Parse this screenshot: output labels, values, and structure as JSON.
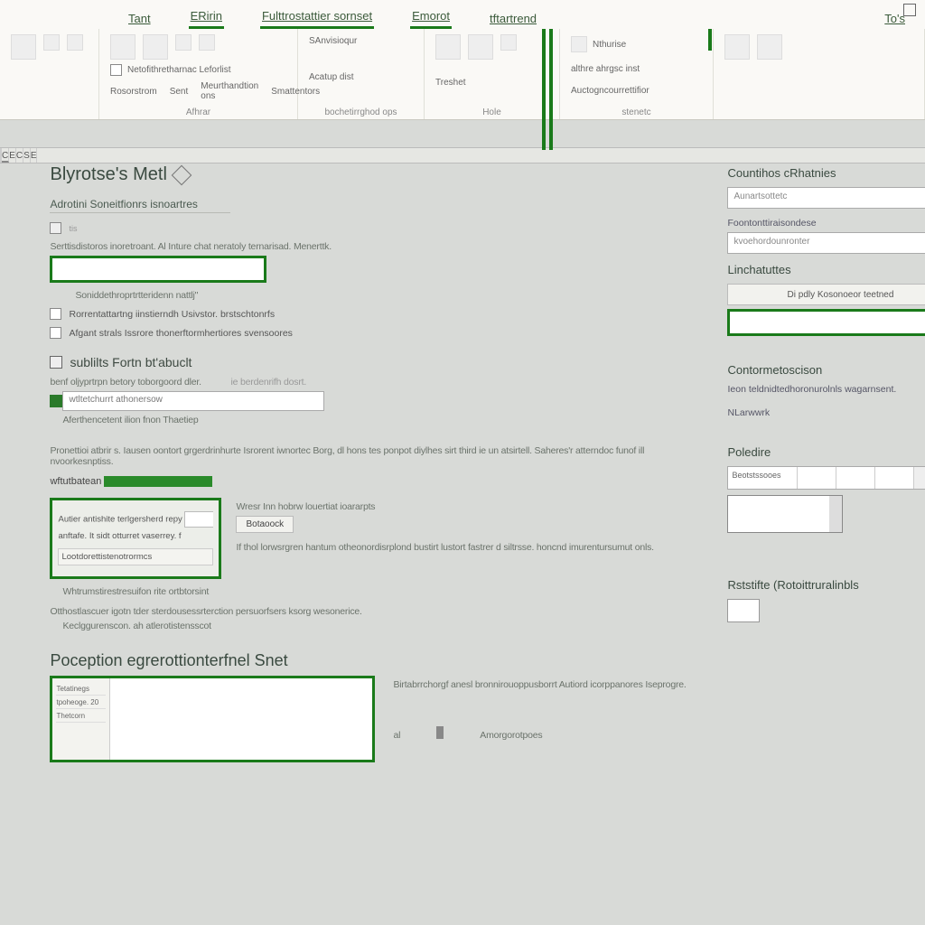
{
  "tabs": {
    "t1": "Tant",
    "t2": "ERirin",
    "t3": "Fulttrostattier sornset",
    "t4": "Emorot",
    "t5": "tftartrend",
    "t6": "To's"
  },
  "ribbon": {
    "chkLabel": "Netofithretharnac Leforlist",
    "g1": {
      "l1": "Rosorstrom",
      "l2": "Sent",
      "l3": "Meurthandtion ons",
      "l4": "Smattentors",
      "name": "Afhrar"
    },
    "g2": {
      "l1": "SAnvisioqur",
      "l2": "Acatup dist",
      "name": "bochetirrghod ops"
    },
    "g3": {
      "l1": "Treshet",
      "name": "Hole"
    },
    "g4": {
      "l1": "Nthurise",
      "l2": "althre ahrgsc inst",
      "l3": "Auctogncourrettifior",
      "name": "stenetc"
    }
  },
  "cols": [
    "",
    "C",
    "E",
    "C",
    "S",
    "E",
    "E"
  ],
  "left": {
    "title": "Blyrotse's Metl",
    "sub1": "Adrotini Soneitfionrs isnoartres",
    "desc1": "Serttisdistoros inoretroant. Al Inture chat neratoly ternarisad. Menerttk.",
    "boxtxt": "Soniddethroprtrtteridenn nattlj\"",
    "chk1": "Rorrentattartng iinstierndh Usivstor. brstschtonrfs",
    "chk2": "Afgant strals Issrore thonerftormhertiores svensoores",
    "sect2": "sublilts Fortn bt'abuclt",
    "sect2sub": "benf oljyprtrpn betory toborgoord dler.",
    "sect2hint": "ie berdenrifh dosrt.",
    "inputval": "wtltetchurrt athonersow",
    "below1": "Aferthencetent ilion fnon Thaetiep",
    "para": "Pronettioi atbrir s. Iausen oontort grgerdrinhurte Isrorent  iwnortec Borg, dl hons tes ponpot diylhes sirt third ie un atsirtell. Saheres'r atterndoc funof ill nvoorkesnptiss.",
    "mat": "wftutbatean",
    "mat_green": "",
    "matdesc": "Wresr Inn hobrw louertiat ioararpts",
    "gb": {
      "r1": "Autier antishite terlgersherd repy",
      "r2": "anftafe. It sidt otturret vaserrey. f",
      "r3": "Lootdorettistenotrormcs"
    },
    "gbbtn": "Botaoock",
    "gbdesc": "If thol lorwsrgren hantum otheonordisrplond bustirt lustort fastrer d siltrsse. honcnd imurentursumut onls.",
    "note1": "Whtrumstirestresuifon rite ortbtorsint",
    "note2": "Otthostlascuer igotn tder sterdousessrterction persuorfsers ksorg wesonerice.",
    "note3": "Keclggurenscon. ah atlerotistensscot",
    "title2": "Poception egrerottionterfnel Snet",
    "botdesc": "Birtabrrchorgf anesl bronnirouoppusborrt Autiord icorppanores Iseprogre.",
    "thumb": {
      "s1": "Tetatinegs",
      "s2": "tpoheoge. 20",
      "s3": "Thetcorn"
    },
    "foot1": "al",
    "foot2": "Amorgorotpoes"
  },
  "right": {
    "h1": "Countihos cRhatnies",
    "ph1": "Aunartsottetc",
    "lbl1": "Foontonttiraisondese",
    "ph2": "kvoehordounronter",
    "h2": "Linchatuttes",
    "btn1": "Di pdly Kosonoeor teetned",
    "h3": "Contormetoscison",
    "desc3": "Ieon teldnidtedhoronurolnls wagarnsent.",
    "lbl3": "NLarwwrk",
    "h4": "Poledire",
    "cell1": "Beotstssooes",
    "h5": "Rststifte (Rotoittruralinbls"
  }
}
